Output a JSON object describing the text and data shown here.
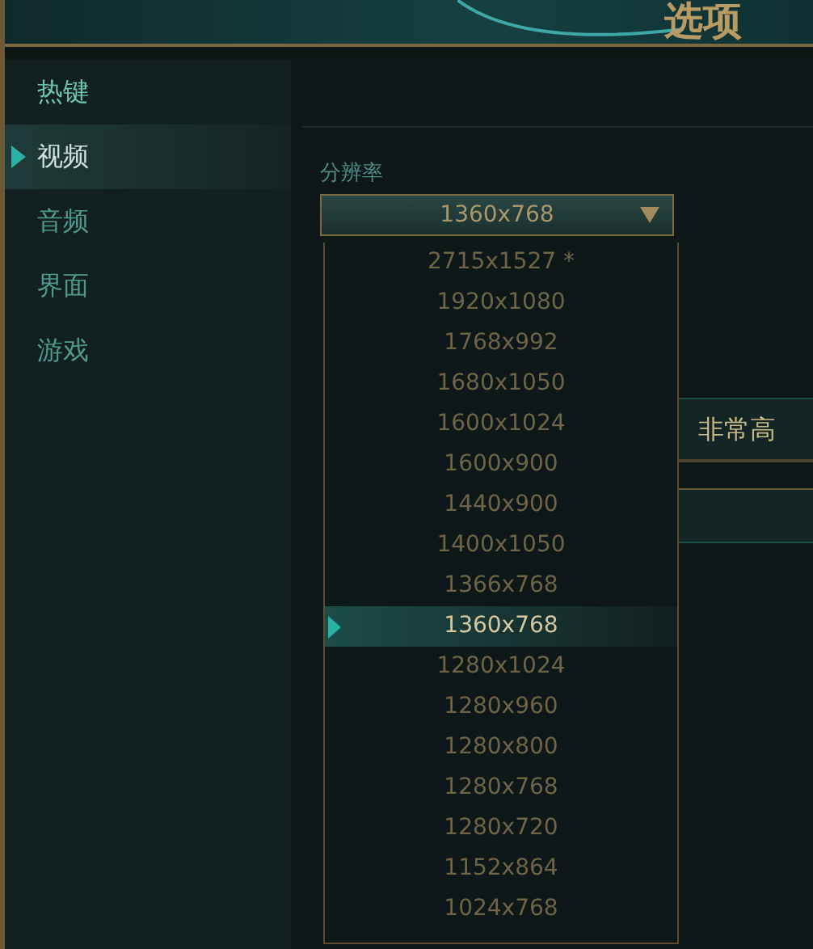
{
  "window": {
    "title": "选项"
  },
  "sidebar": {
    "items": [
      {
        "label": "热键",
        "selected": false
      },
      {
        "label": "视频",
        "selected": true
      },
      {
        "label": "音频",
        "selected": false
      },
      {
        "label": "界面",
        "selected": false
      },
      {
        "label": "游戏",
        "selected": false
      }
    ]
  },
  "resolution": {
    "label": "分辨率",
    "value": "1360x768",
    "expanded": true,
    "options": [
      {
        "label": "2715x1527 *",
        "selected": false
      },
      {
        "label": "1920x1080",
        "selected": false
      },
      {
        "label": "1768x992",
        "selected": false
      },
      {
        "label": "1680x1050",
        "selected": false
      },
      {
        "label": "1600x1024",
        "selected": false
      },
      {
        "label": "1600x900",
        "selected": false
      },
      {
        "label": "1440x900",
        "selected": false
      },
      {
        "label": "1400x1050",
        "selected": false
      },
      {
        "label": "1366x768",
        "selected": false
      },
      {
        "label": "1360x768",
        "selected": true
      },
      {
        "label": "1280x1024",
        "selected": false
      },
      {
        "label": "1280x960",
        "selected": false
      },
      {
        "label": "1280x800",
        "selected": false
      },
      {
        "label": "1280x768",
        "selected": false
      },
      {
        "label": "1280x720",
        "selected": false
      },
      {
        "label": "1152x864",
        "selected": false
      },
      {
        "label": "1024x768",
        "selected": false
      }
    ]
  },
  "quality": {
    "value": "非常高"
  }
}
